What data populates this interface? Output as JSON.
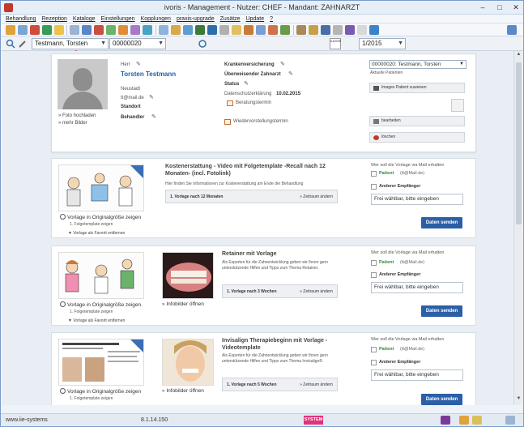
{
  "window": {
    "title": "ivoris - Management - Nutzer: CHEF - Mandant: ZAHNARZT"
  },
  "menu": [
    "Behandlung",
    "Rezeption",
    "Kataloge",
    "Einstellungen",
    "Kopplungen",
    "praxis-upgrade",
    "Zusätze",
    "Update",
    "?"
  ],
  "search": {
    "patient_value": "Testmann, Torsten",
    "patient_number": "00000020",
    "kasse_label": "KASSE",
    "quarter_value": "1/2015"
  },
  "patient": {
    "name_label": "Herr",
    "name": "Torsten Testmann",
    "city": "Neustadt",
    "email": "tt@mail.de",
    "standort_label": "Standort",
    "behandler_label": "Behandler",
    "foto_label": "» Foto hochladen",
    "mehr_bilder_label": "» mehr Bilder",
    "kv_label": "Krankenversicherung",
    "zahnarzt_label": "Überweisender Zahnarzt",
    "status_label": "Status",
    "dsgvo_label": "Datenschutzerklärung",
    "dsgvo_date": "10.02.2015",
    "beratung_label": "Beratungstermin",
    "wiedervorstellung_label": "Wiedervorstellungstermin",
    "select_value": "00000020: Testmann, Torsten",
    "select_hint": "Aktuelle Patienten",
    "bild_btn": "Images Patient zuweisen",
    "edit_btn": "bearbeiten",
    "delete_btn": "löschen"
  },
  "templates": [
    {
      "title": "Kostenerstattung - Video mit Folgetemplate -Recall nach 12 Monaten- (incl. Fotolink)",
      "desc": "Hier finden Sie Informationen zur Kostenerstattung am Ende der Behandlung",
      "schedule": "1. Vorlage nach 12 Monaten",
      "schedule_action": "» Zeitraum ändern",
      "zoom": "Vorlage in Originalgröße zeigen",
      "sub": "1. Folgetemplate zeigen",
      "fav": "Vorlage als Favorit entfernen",
      "mail_head": "Wer soll die Vorlage via Mail erhalten",
      "patient_label": "Patient",
      "patient_mail": "(tt@Mail.de)",
      "other_label": "Anderer Empfänger",
      "free_placeholder": "Frei wählbar, bitte eingeben",
      "send": "Daten senden"
    },
    {
      "title": "Retainer mit Vorlage",
      "desc": "Als Experten für die Zahnentwicklung geben wir Ihnen gern unterstützende Hilfen und Tipps zum Thema Retainer.",
      "schedule": "1. Vorlage nach 3 Wochen",
      "schedule_action": "» Zeitraum ändern",
      "zoom": "Vorlage in Originalgröße zeigen",
      "sub": "1. Folgetemplate zeigen",
      "fav": "Vorlage als Favorit entfernen",
      "infobild": "Infobilder öffnen",
      "mail_head": "Wer soll die Vorlage via Mail erhalten",
      "patient_label": "Patient",
      "patient_mail": "(tt@Mail.de)",
      "other_label": "Anderer Empfänger",
      "free_placeholder": "Frei wählbar, bitte eingeben",
      "send": "Daten senden"
    },
    {
      "title": "Invisalign Therapiebeginn mit Vorlage - Videotemplate",
      "desc": "Als Experten für die Zahnentwicklung geben wir Ihnen gern unterstützende Hilfen und Tipps zum Thema Invisalign®.",
      "schedule": "1. Vorlage nach 5 Wochen",
      "schedule_action": "» Zeitraum ändern",
      "zoom": "Vorlage in Originalgröße zeigen",
      "sub": "1. Folgetemplate zeigen",
      "infobild": "Infobilder öffnen",
      "mail_head": "Wer soll die Vorlage via Mail erhalten",
      "patient_label": "Patient",
      "patient_mail": "(tt@Mail.de)",
      "other_label": "Anderer Empfänger",
      "free_placeholder": "Frei wählbar, bitte eingeben",
      "send": "Daten senden"
    }
  ],
  "status": {
    "site": "www.iie-systems",
    "version": "8.1.14.150",
    "system": "SYSTEM"
  }
}
